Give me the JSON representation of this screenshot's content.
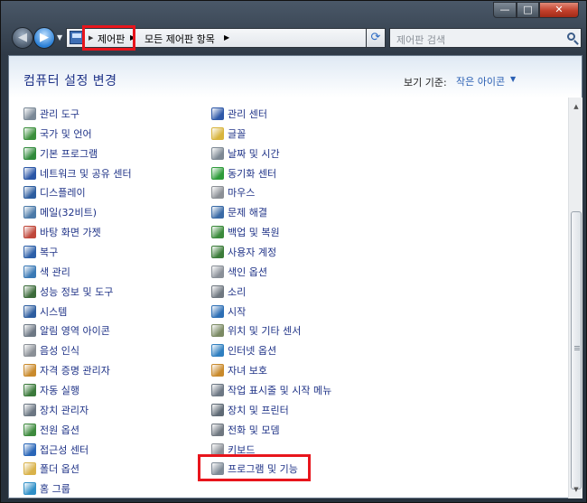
{
  "window": {
    "caption_buttons": {
      "minimize": "—",
      "maximize": "□",
      "close": "✕"
    }
  },
  "nav": {
    "back_glyph": "◀",
    "forward_glyph": "▶",
    "history_drop_glyph": "▼",
    "breadcrumb": [
      "제어판",
      "모든 제어판 항목"
    ],
    "crumb_separator": "▶",
    "address_drop_glyph": "▼",
    "refresh_glyph": "⟳",
    "search_placeholder": "제어판 검색"
  },
  "header": {
    "title": "컴퓨터 설정 변경",
    "view_label": "보기 기준:",
    "view_value": "작은 아이콘",
    "view_drop_glyph": "▼"
  },
  "items": {
    "left": [
      {
        "label": "관리 도구",
        "icon": "admin-tools-icon",
        "color": "#7a8896"
      },
      {
        "label": "국가 및 언어",
        "icon": "region-language-icon",
        "color": "#3b8f3b"
      },
      {
        "label": "기본 프로그램",
        "icon": "default-programs-icon",
        "color": "#2f8a3a"
      },
      {
        "label": "네트워크 및 공유 센터",
        "icon": "network-sharing-icon",
        "color": "#2a56a6"
      },
      {
        "label": "디스플레이",
        "icon": "display-icon",
        "color": "#2d5d9f"
      },
      {
        "label": "메일(32비트)",
        "icon": "mail-icon",
        "color": "#4b7aa8"
      },
      {
        "label": "바탕 화면 가젯",
        "icon": "desktop-gadgets-icon",
        "color": "#c0473a"
      },
      {
        "label": "복구",
        "icon": "recovery-icon",
        "color": "#2c5fa8"
      },
      {
        "label": "색 관리",
        "icon": "color-management-icon",
        "color": "#3a79b5"
      },
      {
        "label": "성능 정보 및 도구",
        "icon": "performance-icon",
        "color": "#3c6b3a"
      },
      {
        "label": "시스템",
        "icon": "system-icon",
        "color": "#2d5d9f"
      },
      {
        "label": "알림 영역 아이콘",
        "icon": "notification-area-icon",
        "color": "#6d7884"
      },
      {
        "label": "음성 인식",
        "icon": "speech-recognition-icon",
        "color": "#8a8f96"
      },
      {
        "label": "자격 증명 관리자",
        "icon": "credential-manager-icon",
        "color": "#c98a2c"
      },
      {
        "label": "자동 실행",
        "icon": "autoplay-icon",
        "color": "#3b7a3b"
      },
      {
        "label": "장치 관리자",
        "icon": "device-manager-icon",
        "color": "#6b7682"
      },
      {
        "label": "전원 옵션",
        "icon": "power-options-icon",
        "color": "#3d8a3d"
      },
      {
        "label": "접근성 센터",
        "icon": "ease-of-access-icon",
        "color": "#2a66b8"
      },
      {
        "label": "폴더 옵션",
        "icon": "folder-options-icon",
        "color": "#d9b24a"
      },
      {
        "label": "홈 그룹",
        "icon": "homegroup-icon",
        "color": "#2f8fc7"
      }
    ],
    "right": [
      {
        "label": "관리 센터",
        "icon": "action-center-icon",
        "color": "#2e58a8"
      },
      {
        "label": "글꼴",
        "icon": "fonts-icon",
        "color": "#d8b43c"
      },
      {
        "label": "날짜 및 시간",
        "icon": "date-time-icon",
        "color": "#7d8893"
      },
      {
        "label": "동기화 센터",
        "icon": "sync-center-icon",
        "color": "#2e9b3a"
      },
      {
        "label": "마우스",
        "icon": "mouse-icon",
        "color": "#8b8f95"
      },
      {
        "label": "문제 해결",
        "icon": "troubleshooting-icon",
        "color": "#3a6aa6"
      },
      {
        "label": "백업 및 복원",
        "icon": "backup-restore-icon",
        "color": "#3b8a3b"
      },
      {
        "label": "사용자 계정",
        "icon": "user-accounts-icon",
        "color": "#3c7c3a"
      },
      {
        "label": "색인 옵션",
        "icon": "indexing-options-icon",
        "color": "#8a9098"
      },
      {
        "label": "소리",
        "icon": "sound-icon",
        "color": "#6f7780"
      },
      {
        "label": "시작",
        "icon": "getting-started-icon",
        "color": "#2e6fb5"
      },
      {
        "label": "위치 및 기타 센서",
        "icon": "location-sensors-icon",
        "color": "#7b8a63"
      },
      {
        "label": "인터넷 옵션",
        "icon": "internet-options-icon",
        "color": "#2f7fc0"
      },
      {
        "label": "자녀 보호",
        "icon": "parental-controls-icon",
        "color": "#c98a2c"
      },
      {
        "label": "작업 표시줄 및 시작 메뉴",
        "icon": "taskbar-start-icon",
        "color": "#6d7884"
      },
      {
        "label": "장치 및 프린터",
        "icon": "devices-printers-icon",
        "color": "#5f6a75"
      },
      {
        "label": "전화 및 모뎀",
        "icon": "phone-modem-icon",
        "color": "#6f7780"
      },
      {
        "label": "키보드",
        "icon": "keyboard-icon",
        "color": "#8b9097"
      },
      {
        "label": "프로그램 및 기능",
        "icon": "programs-features-icon",
        "color": "#7e8a96"
      }
    ]
  },
  "scrollbar": {
    "up_glyph": "▲",
    "down_glyph": "▼"
  },
  "highlight_color": "#e8151c"
}
